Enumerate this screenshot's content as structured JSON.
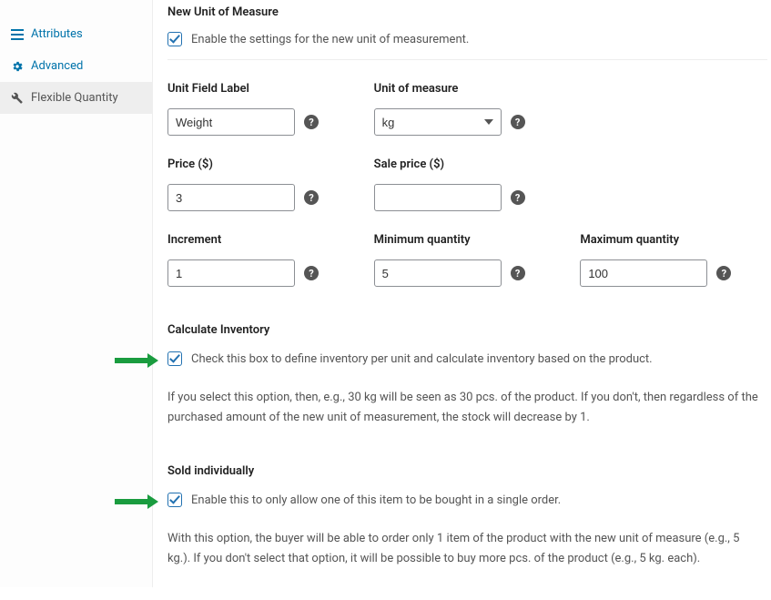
{
  "sidebar": {
    "items": [
      {
        "label": "Attributes"
      },
      {
        "label": "Advanced"
      },
      {
        "label": "Flexible Quantity"
      }
    ]
  },
  "header": {
    "title": "New Unit of Measure",
    "enable_label": "Enable the settings for the new unit of measurement.",
    "enable_checked": true
  },
  "fields": {
    "unit_label": {
      "label": "Unit Field Label",
      "value": "Weight"
    },
    "unit_measure": {
      "label": "Unit of measure",
      "value": "kg"
    },
    "price": {
      "label": "Price ($)",
      "value": "3"
    },
    "sale_price": {
      "label": "Sale price ($)",
      "value": ""
    },
    "increment": {
      "label": "Increment",
      "value": "1"
    },
    "min_qty": {
      "label": "Minimum quantity",
      "value": "5"
    },
    "max_qty": {
      "label": "Maximum quantity",
      "value": "100"
    }
  },
  "calc_inventory": {
    "title": "Calculate Inventory",
    "checkbox_label": "Check this box to define inventory per unit and calculate inventory based on the product.",
    "checked": true,
    "description": "If you select this option, then, e.g., 30 kg will be seen as 30 pcs. of the product. If you don't, then regardless of the purchased amount of the new unit of measurement, the stock will decrease by 1."
  },
  "sold_individually": {
    "title": "Sold individually",
    "checkbox_label": "Enable this to only allow one of this item to be bought in a single order.",
    "checked": true,
    "description": "With this option, the buyer will be able to order only 1 item of the product with the new unit of measure (e.g., 5 kg.). If you don't select that option, it will be possible to buy more pcs. of the product (e.g., 5 kg. each)."
  }
}
